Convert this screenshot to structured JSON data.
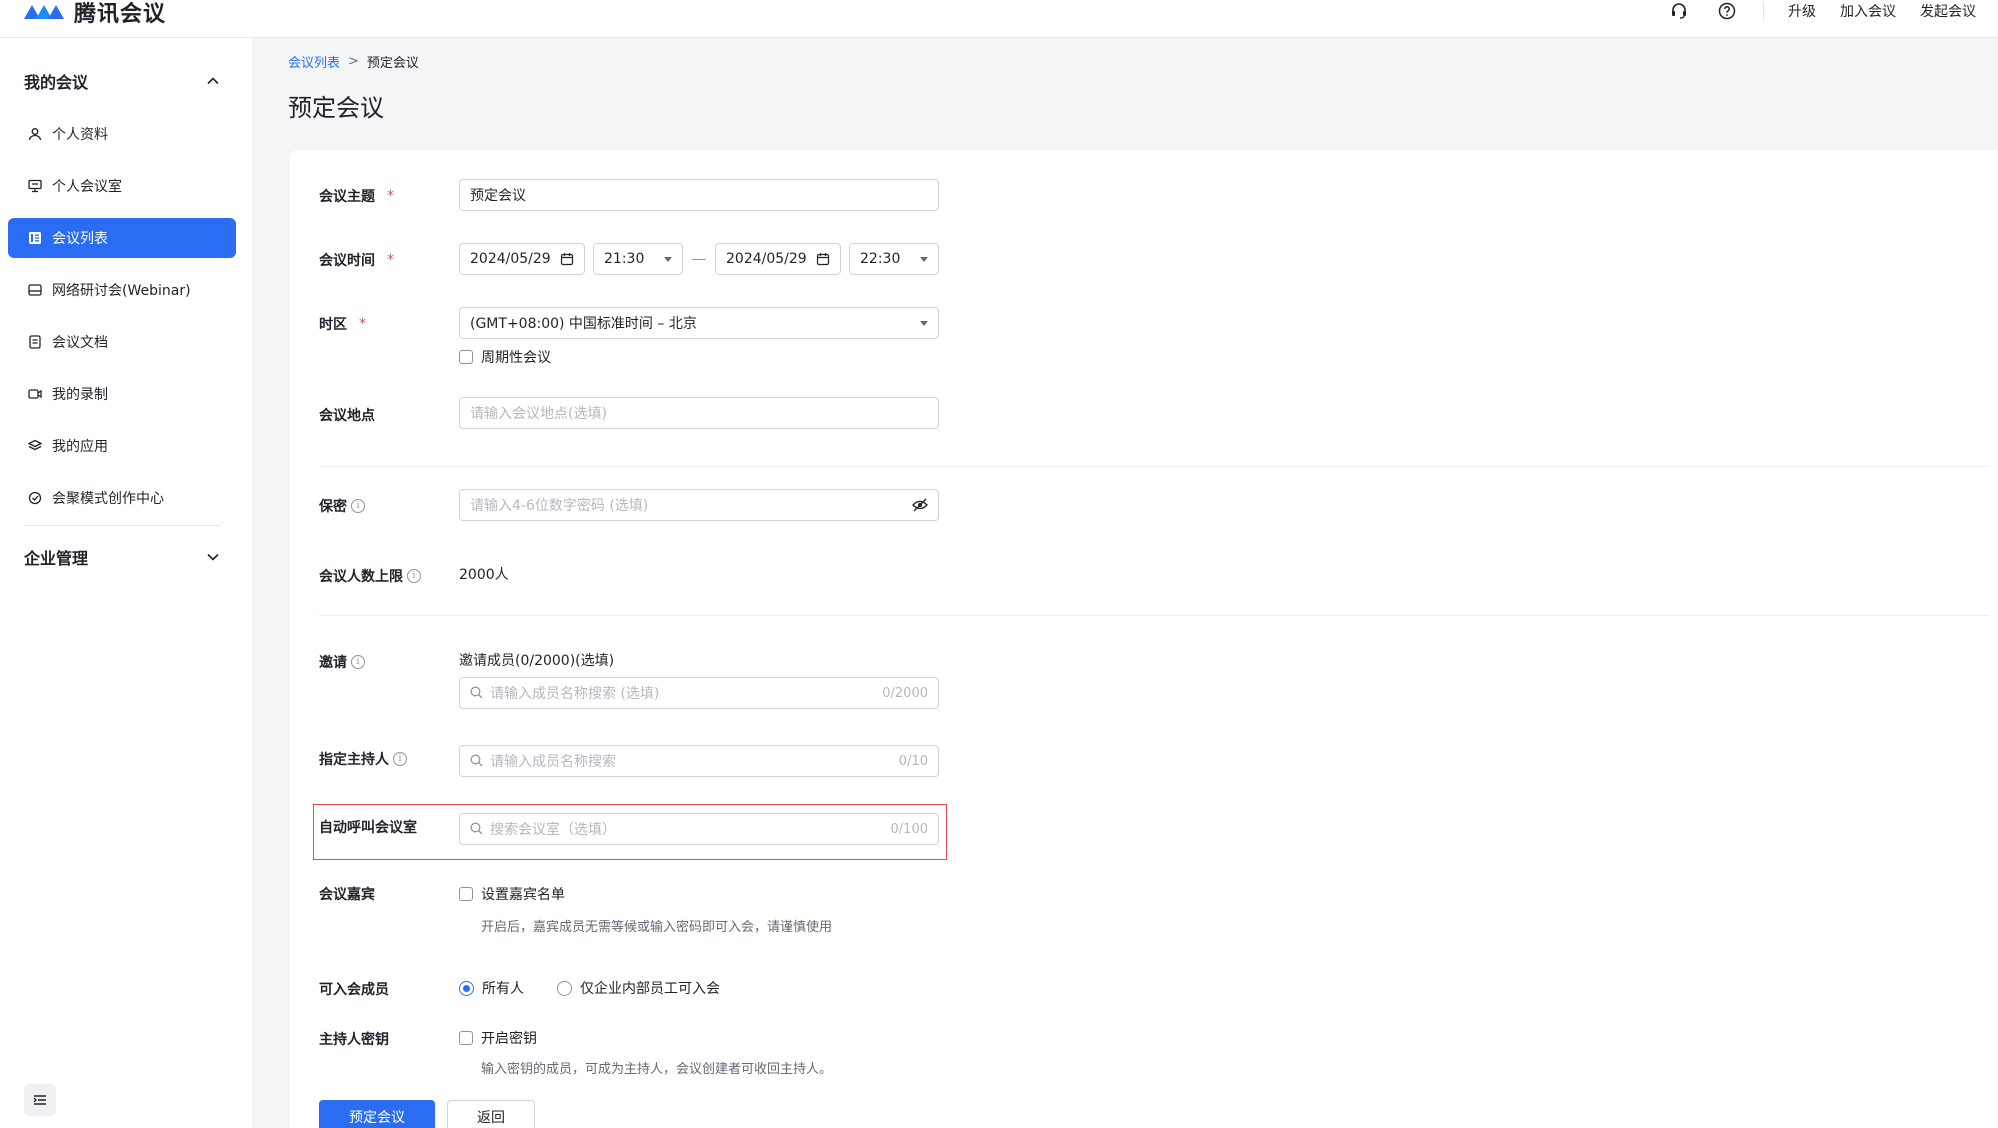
{
  "app": {
    "name": "腾讯会议"
  },
  "topbar": {
    "upgrade": "升级",
    "join": "加入会议",
    "start": "发起会议",
    "support_icon": "headset-icon",
    "help_icon": "help-icon"
  },
  "sidebar": {
    "group_my": "我的会议",
    "items": [
      {
        "label": "个人资料",
        "icon": "user-icon"
      },
      {
        "label": "个人会议室",
        "icon": "meeting-room-icon"
      },
      {
        "label": "会议列表",
        "icon": "list-icon",
        "active": true
      },
      {
        "label": "网络研讨会(Webinar)",
        "icon": "webinar-icon"
      },
      {
        "label": "会议文档",
        "icon": "document-icon"
      },
      {
        "label": "我的录制",
        "icon": "recording-icon"
      },
      {
        "label": "我的应用",
        "icon": "apps-icon"
      },
      {
        "label": "会聚模式创作中心",
        "icon": "creation-icon"
      }
    ],
    "group_enterprise": "企业管理"
  },
  "breadcrumb": {
    "parent": "会议列表",
    "sep": ">",
    "current": "预定会议"
  },
  "page_title": "预定会议",
  "form": {
    "topic": {
      "label": "会议主题",
      "required": "*",
      "value": "预定会议"
    },
    "time": {
      "label": "会议时间",
      "required": "*",
      "start_date": "2024/05/29",
      "start_time": "21:30",
      "end_date": "2024/05/29",
      "end_time": "22:30"
    },
    "timezone": {
      "label": "时区",
      "required": "*",
      "value": "(GMT+08:00) 中国标准时间 – 北京",
      "recurring": "周期性会议"
    },
    "location": {
      "label": "会议地点",
      "placeholder": "请输入会议地点(选填)"
    },
    "password": {
      "label": "保密",
      "placeholder": "请输入4-6位数字密码 (选填)"
    },
    "capacity": {
      "label": "会议人数上限",
      "value": "2000人"
    },
    "invite": {
      "label": "邀请",
      "title": "邀请成员(0/2000)(选填)",
      "placeholder": "请输入成员名称搜索 (选填)",
      "count": "0/2000"
    },
    "host": {
      "label": "指定主持人",
      "placeholder": "请输入成员名称搜索",
      "count": "0/10"
    },
    "auto_call": {
      "label": "自动呼叫会议室",
      "placeholder": "搜索会议室（选填）",
      "count": "0/100"
    },
    "guest": {
      "label": "会议嘉宾",
      "option": "设置嘉宾名单",
      "hint": "开启后，嘉宾成员无需等候或输入密码即可入会，请谨慎使用"
    },
    "members": {
      "label": "可入会成员",
      "option_all": "所有人",
      "option_internal": "仅企业内部员工可入会"
    },
    "host_key": {
      "label": "主持人密钥",
      "option": "开启密钥",
      "hint": "输入密钥的成员，可成为主持人，会议创建者可收回主持人。"
    }
  },
  "actions": {
    "submit": "预定会议",
    "back": "返回"
  }
}
